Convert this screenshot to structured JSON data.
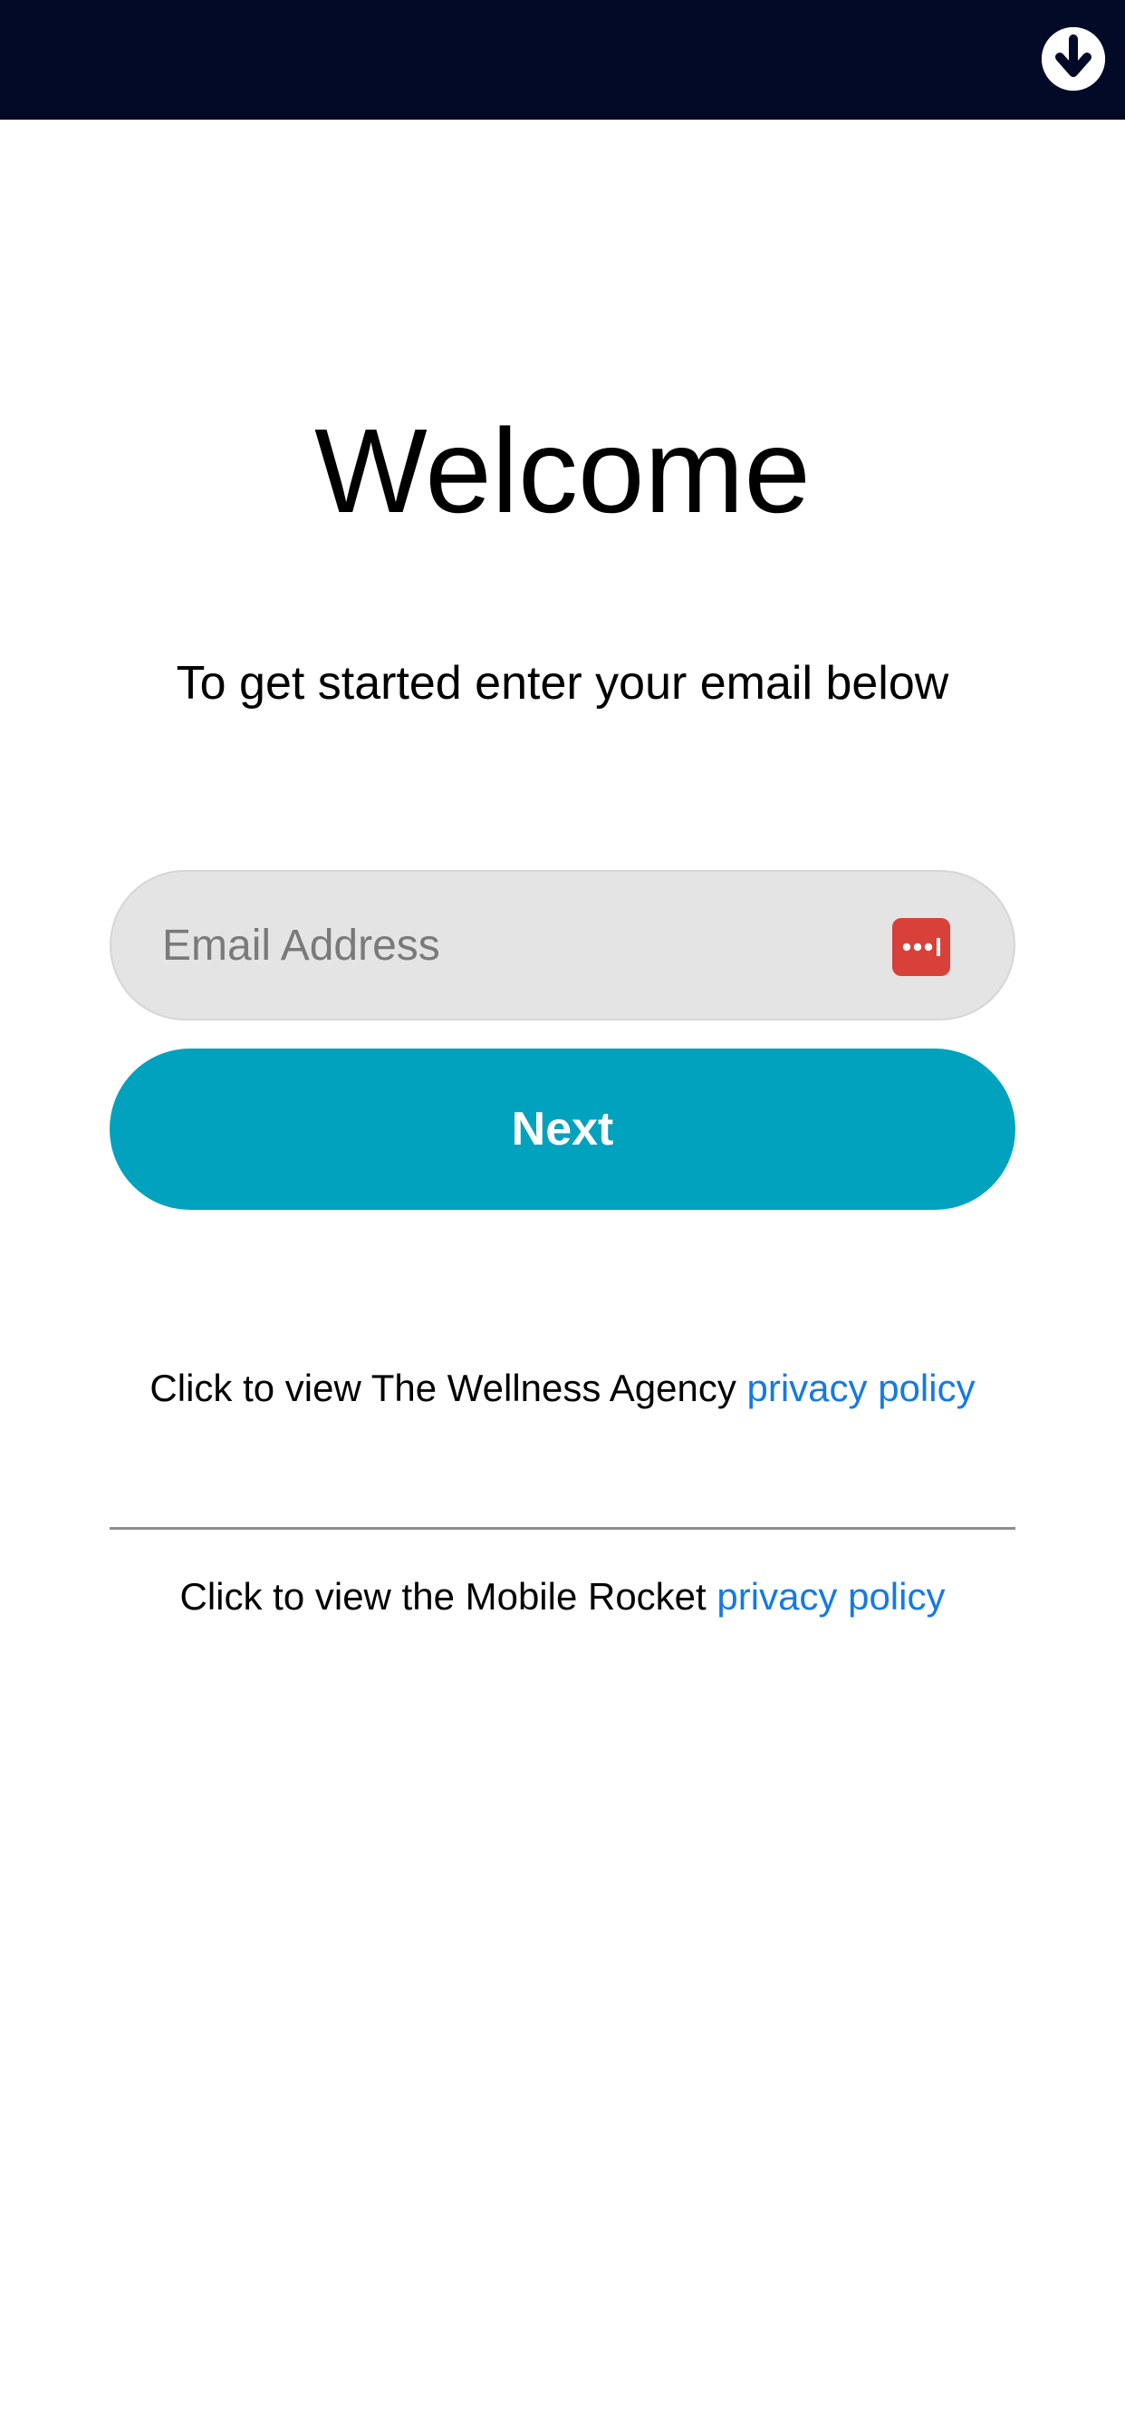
{
  "colors": {
    "top_bar": "#030a27",
    "accent": "#00a2bd",
    "link": "#1479e6",
    "field_background": "#e4e4e4",
    "password_manager_icon": "#d8403a"
  },
  "header": {
    "download_icon": "arrow-down-circle-icon"
  },
  "welcome": {
    "title": "Welcome",
    "subtitle": "To get started enter your email below"
  },
  "form": {
    "email_placeholder": "Email Address",
    "email_value": "",
    "password_manager_icon": "password-dots-icon",
    "next_label": "Next"
  },
  "policies": {
    "agency_prefix": "Click to view The Wellness Agency ",
    "agency_link": "privacy policy",
    "mobile_prefix": "Click to view the Mobile Rocket ",
    "mobile_link": "privacy policy"
  }
}
